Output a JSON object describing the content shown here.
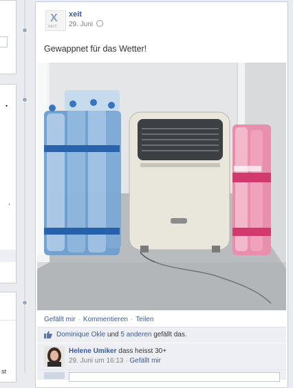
{
  "left_column": {
    "snippet_comma": ",",
    "snippet_bottom": "st"
  },
  "post": {
    "author": "xeit",
    "date": "29. Juni",
    "avatar_logo": "X",
    "avatar_tag": "XEIT",
    "text": "Gewappnet für das Wetter!",
    "photo_alt": "Mobile Klimaanlage neben Wasserflaschen",
    "actions": {
      "like": "Gefällt mir",
      "comment": "Kommentieren",
      "share": "Teilen"
    },
    "likes": {
      "person": "Dominique Okle",
      "connector": "und",
      "others": "5 anderen",
      "suffix": "gefällt das."
    },
    "comment": {
      "author": "Helene Umiker",
      "text": "dass heisst 30+",
      "date": "29. Juni um 16:13",
      "like": "Gefällt mir"
    }
  },
  "colors": {
    "link": "#3b5998",
    "background": "#e9ebee",
    "likes_bg": "#edeff4"
  },
  "icons": [
    "globe-icon",
    "like-icon"
  ]
}
